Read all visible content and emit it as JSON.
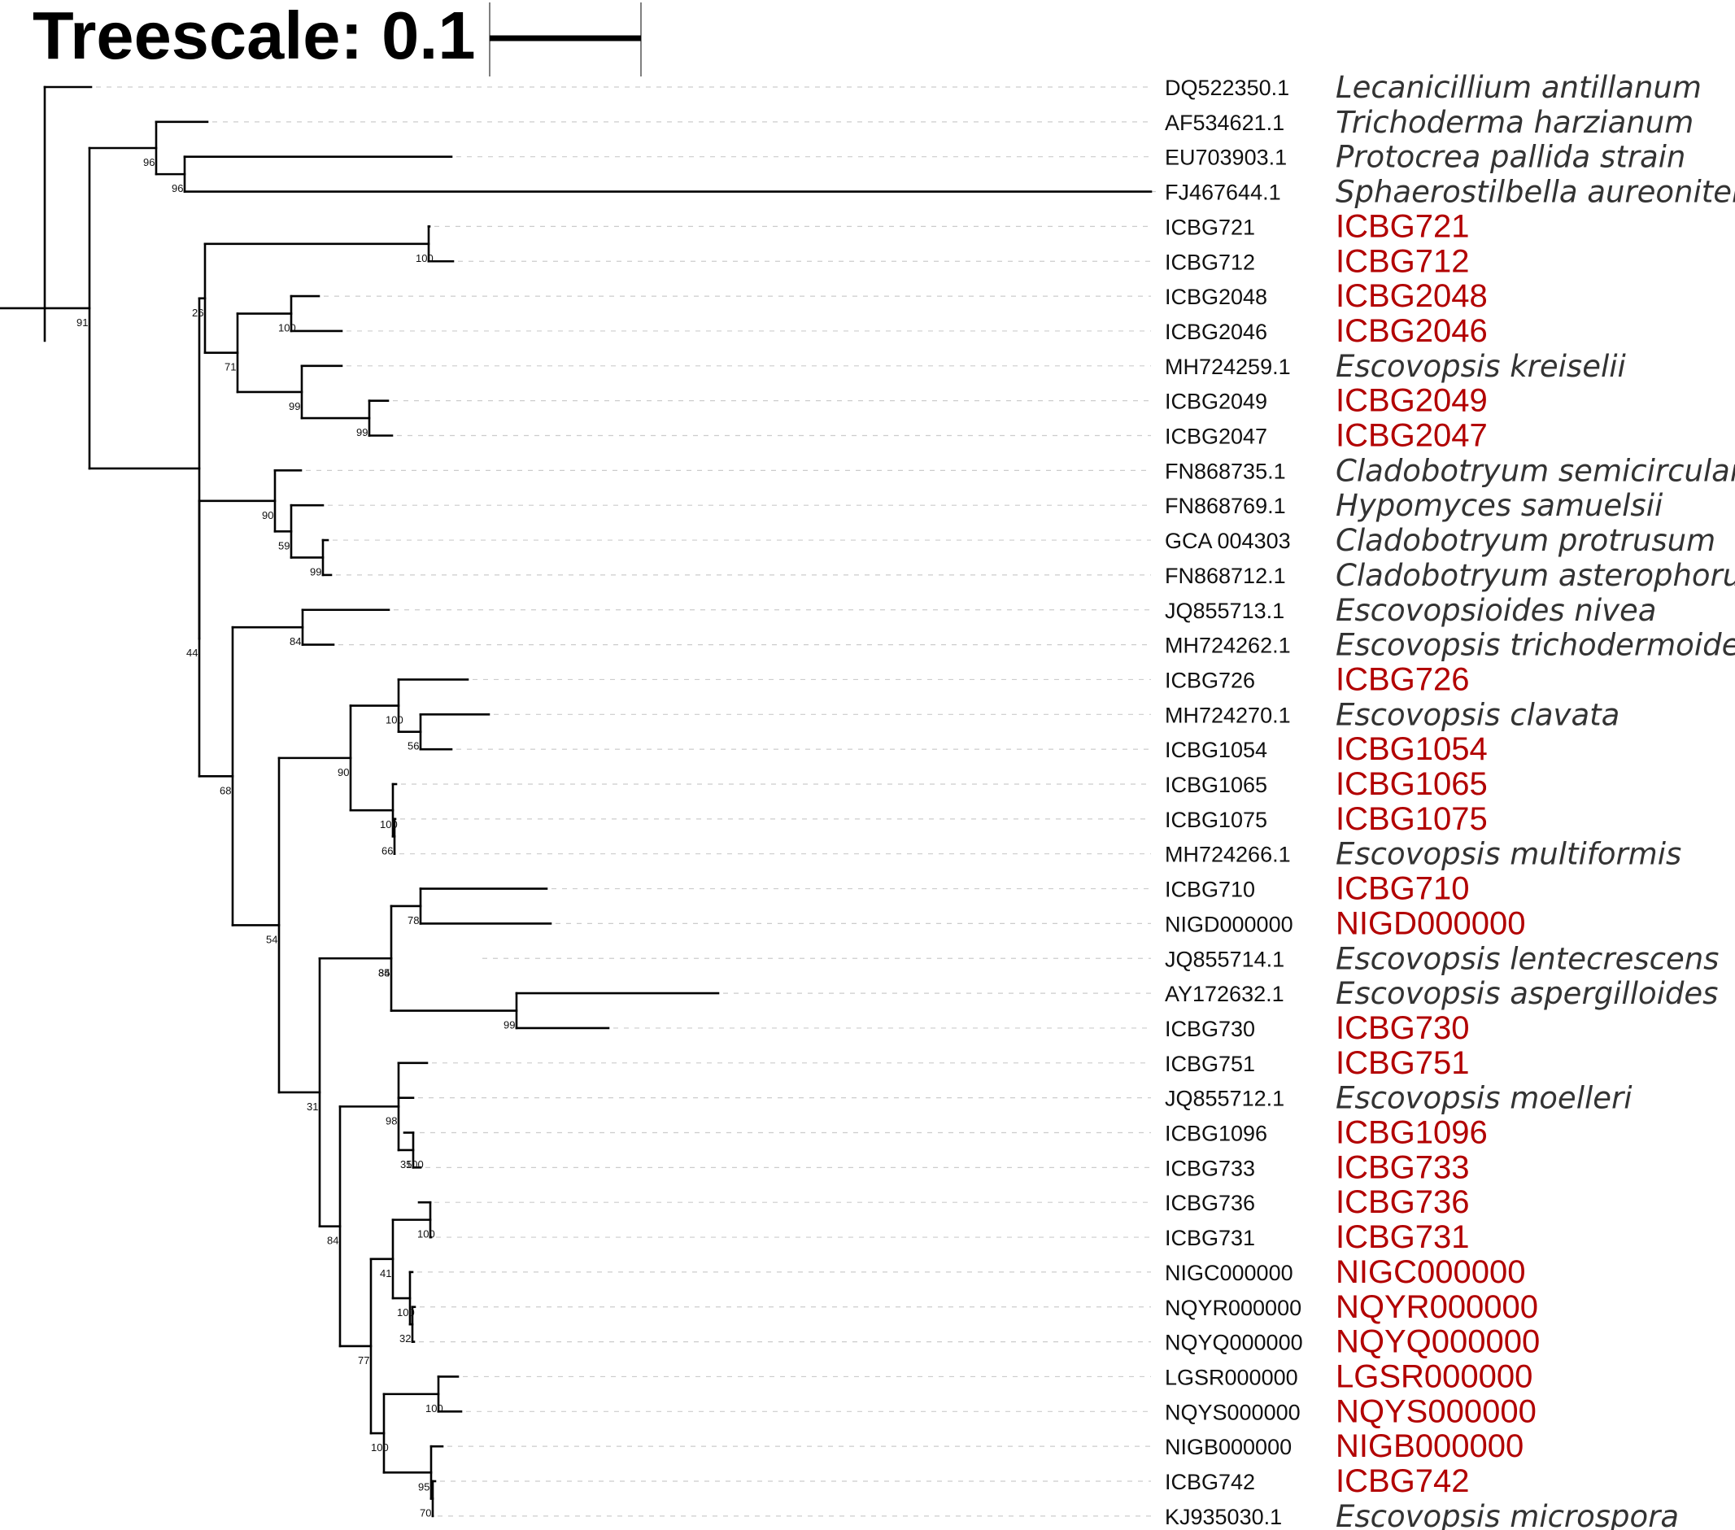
{
  "scale": {
    "label": "Treescale: 0.1",
    "value": 0.1
  },
  "colors": {
    "branch": "#000000",
    "isolate_label": "#b20000",
    "species_label": "#333333",
    "guide_line": "#cccccc"
  },
  "leaves": [
    {
      "id": "L1",
      "accession": "DQ522350.1",
      "name": "Lecanicillium antillanum",
      "isolate": false
    },
    {
      "id": "L2",
      "accession": "AF534621.1",
      "name": "Trichoderma harzianum",
      "isolate": false
    },
    {
      "id": "L3",
      "accession": "EU703903.1",
      "name": "Protocrea pallida strain",
      "isolate": false
    },
    {
      "id": "L4",
      "accession": "FJ467644.1",
      "name": "Sphaerostilbella aureonitens",
      "isolate": false
    },
    {
      "id": "L5",
      "accession": "ICBG721",
      "name": "ICBG721",
      "isolate": true
    },
    {
      "id": "L6",
      "accession": "ICBG712",
      "name": "ICBG712",
      "isolate": true
    },
    {
      "id": "L7",
      "accession": "ICBG2048",
      "name": "ICBG2048",
      "isolate": true
    },
    {
      "id": "L8",
      "accession": "ICBG2046",
      "name": "ICBG2046",
      "isolate": true
    },
    {
      "id": "L9",
      "accession": "MH724259.1",
      "name": "Escovopsis kreiselii",
      "isolate": false
    },
    {
      "id": "L10",
      "accession": "ICBG2049",
      "name": "ICBG2049",
      "isolate": true
    },
    {
      "id": "L11",
      "accession": "ICBG2047",
      "name": "ICBG2047",
      "isolate": true
    },
    {
      "id": "L12",
      "accession": "FN868735.1",
      "name": "Cladobotryum semicirculare",
      "isolate": false
    },
    {
      "id": "L13",
      "accession": "FN868769.1",
      "name": "Hypomyces samuelsii",
      "isolate": false
    },
    {
      "id": "L14",
      "accession": "GCA 004303",
      "name": "Cladobotryum protrusum",
      "isolate": false
    },
    {
      "id": "L15",
      "accession": "FN868712.1",
      "name": "Cladobotryum asterophorum",
      "isolate": false
    },
    {
      "id": "L16",
      "accession": "JQ855713.1",
      "name": "Escovopsioides nivea",
      "isolate": false
    },
    {
      "id": "L17",
      "accession": "MH724262.1",
      "name": "Escovopsis trichodermoides",
      "isolate": false
    },
    {
      "id": "L18",
      "accession": "ICBG726",
      "name": "ICBG726",
      "isolate": true
    },
    {
      "id": "L19",
      "accession": "MH724270.1",
      "name": "Escovopsis clavata",
      "isolate": false
    },
    {
      "id": "L20",
      "accession": "ICBG1054",
      "name": "ICBG1054",
      "isolate": true
    },
    {
      "id": "L21",
      "accession": "ICBG1065",
      "name": "ICBG1065",
      "isolate": true
    },
    {
      "id": "L22",
      "accession": "ICBG1075",
      "name": "ICBG1075",
      "isolate": true
    },
    {
      "id": "L23",
      "accession": "MH724266.1",
      "name": "Escovopsis multiformis",
      "isolate": false
    },
    {
      "id": "L24",
      "accession": "ICBG710",
      "name": "ICBG710",
      "isolate": true
    },
    {
      "id": "L25",
      "accession": "NIGD000000",
      "name": "NIGD000000",
      "isolate": true
    },
    {
      "id": "L26",
      "accession": "JQ855714.1",
      "name": "Escovopsis lentecrescens",
      "isolate": false
    },
    {
      "id": "L27",
      "accession": "AY172632.1",
      "name": "Escovopsis aspergilloides",
      "isolate": false
    },
    {
      "id": "L28",
      "accession": "ICBG730",
      "name": "ICBG730",
      "isolate": true
    },
    {
      "id": "L29",
      "accession": "ICBG751",
      "name": "ICBG751",
      "isolate": true
    },
    {
      "id": "L30",
      "accession": "JQ855712.1",
      "name": "Escovopsis moelleri",
      "isolate": false
    },
    {
      "id": "L31",
      "accession": "ICBG1096",
      "name": "ICBG1096",
      "isolate": true
    },
    {
      "id": "L32",
      "accession": "ICBG733",
      "name": "ICBG733",
      "isolate": true
    },
    {
      "id": "L33",
      "accession": "ICBG736",
      "name": "ICBG736",
      "isolate": true
    },
    {
      "id": "L34",
      "accession": "ICBG731",
      "name": "ICBG731",
      "isolate": true
    },
    {
      "id": "L35",
      "accession": "NIGC000000",
      "name": "NIGC000000",
      "isolate": true
    },
    {
      "id": "L36",
      "accession": "NQYR000000",
      "name": "NQYR000000",
      "isolate": true
    },
    {
      "id": "L37",
      "accession": "NQYQ000000",
      "name": "NQYQ000000",
      "isolate": true
    },
    {
      "id": "L38",
      "accession": "LGSR000000",
      "name": "LGSR000000",
      "isolate": true
    },
    {
      "id": "L39",
      "accession": "NQYS000000",
      "name": "NQYS000000",
      "isolate": true
    },
    {
      "id": "L40",
      "accession": "NIGB000000",
      "name": "NIGB000000",
      "isolate": true
    },
    {
      "id": "L41",
      "accession": "ICBG742",
      "name": "ICBG742",
      "isolate": true
    },
    {
      "id": "L42",
      "accession": "KJ935030.1",
      "name": "Escovopsis microspora",
      "isolate": false
    }
  ],
  "support_values": [
    {
      "node": "N_root_out",
      "value": "91"
    },
    {
      "node": "N_out",
      "value": "96"
    },
    {
      "node": "N_hyp",
      "value": "96"
    },
    {
      "node": "N_721",
      "value": "100"
    },
    {
      "node": "N_escA",
      "value": "26"
    },
    {
      "node": "N_2048",
      "value": "100"
    },
    {
      "node": "N_71",
      "value": "71"
    },
    {
      "node": "N_99a",
      "value": "99"
    },
    {
      "node": "N_99b",
      "value": "99"
    },
    {
      "node": "N_clado90",
      "value": "90"
    },
    {
      "node": "N_clado59",
      "value": "59"
    },
    {
      "node": "N_clado99",
      "value": "99"
    },
    {
      "node": "N_44",
      "value": "44"
    },
    {
      "node": "N_84a",
      "value": "84"
    },
    {
      "node": "N_68",
      "value": "68"
    },
    {
      "node": "N_100c",
      "value": "100"
    },
    {
      "node": "N_56",
      "value": "56"
    },
    {
      "node": "N_90b",
      "value": "90"
    },
    {
      "node": "N_100d",
      "value": "100"
    },
    {
      "node": "N_66",
      "value": "66"
    },
    {
      "node": "N_54",
      "value": "54"
    },
    {
      "node": "N_78",
      "value": "78"
    },
    {
      "node": "N_85",
      "value": "85"
    },
    {
      "node": "N_34",
      "value": "34"
    },
    {
      "node": "N_99c",
      "value": "99"
    },
    {
      "node": "N_31",
      "value": "31"
    },
    {
      "node": "N_98",
      "value": "98"
    },
    {
      "node": "N_35",
      "value": "35"
    },
    {
      "node": "N_100e",
      "value": "100"
    },
    {
      "node": "N_84b",
      "value": "84"
    },
    {
      "node": "N_100f",
      "value": "100"
    },
    {
      "node": "N_41",
      "value": "41"
    },
    {
      "node": "N_100g",
      "value": "100"
    },
    {
      "node": "N_32",
      "value": "32"
    },
    {
      "node": "N_77",
      "value": "77"
    },
    {
      "node": "N_100h",
      "value": "100"
    },
    {
      "node": "N_100i",
      "value": "100"
    },
    {
      "node": "N_95",
      "value": "95"
    },
    {
      "node": "N_70",
      "value": "70"
    }
  ]
}
